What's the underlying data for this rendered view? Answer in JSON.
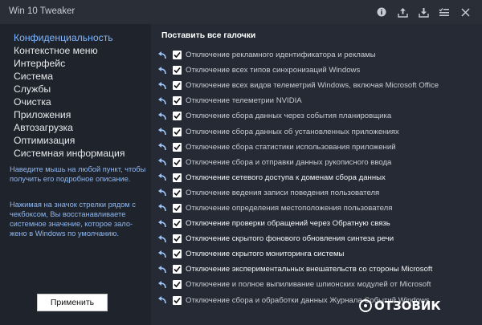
{
  "window": {
    "title": "Win 10 Tweaker"
  },
  "titlebar_icons": [
    "info-icon",
    "export-icon",
    "import-icon",
    "checklist-icon",
    "close-icon"
  ],
  "sidebar": {
    "items": [
      {
        "label": "Конфиденциальность",
        "active": true
      },
      {
        "label": "Контекстное меню",
        "active": false
      },
      {
        "label": "Интерфейс",
        "active": false
      },
      {
        "label": "Система",
        "active": false
      },
      {
        "label": "Службы",
        "active": false
      },
      {
        "label": "Очистка",
        "active": false
      },
      {
        "label": "Приложения",
        "active": false
      },
      {
        "label": "Автозагрузка",
        "active": false
      },
      {
        "label": "Оптимизация",
        "active": false
      },
      {
        "label": "Системная информация",
        "active": false
      }
    ],
    "hint1": "Наведите мышь на любой пункт, чтобы получить его подробное описание.",
    "hint2": "Нажимая на значок стрелки рядом с чекбоксом, Вы восстанавливаете системное значение, которое зало-\nжено в Windows по умолчанию.",
    "apply_label": "Применить"
  },
  "main": {
    "header": "Поставить все галочки",
    "options": [
      {
        "label": "Отключение рекламного идентификатора и рекламы",
        "checked": true,
        "bright": false
      },
      {
        "label": "Отключение всех типов синхронизаций Windows",
        "checked": true,
        "bright": false
      },
      {
        "label": "Отключение всех видов телеметрий Windows, включая Microsoft Office",
        "checked": true,
        "bright": false
      },
      {
        "label": "Отключение телеметрии NVIDIA",
        "checked": true,
        "bright": false
      },
      {
        "label": "Отключение сбора данных через события планировщика",
        "checked": true,
        "bright": false
      },
      {
        "label": "Отключение сбора данных об установленных приложениях",
        "checked": true,
        "bright": false
      },
      {
        "label": "Отключение сбора статистики использования приложений",
        "checked": true,
        "bright": false
      },
      {
        "label": "Отключение сбора и отправки данных рукописного ввода",
        "checked": true,
        "bright": false
      },
      {
        "label": "Отключение сетевого доступа к доменам сбора данных",
        "checked": true,
        "bright": true
      },
      {
        "label": "Отключение ведения записи поведения пользователя",
        "checked": true,
        "bright": false
      },
      {
        "label": "Отключение определения местоположения пользователя",
        "checked": true,
        "bright": false
      },
      {
        "label": "Отключение проверки обращений через Обратную связь",
        "checked": true,
        "bright": true
      },
      {
        "label": "Отключение скрытого фонового обновления синтеза речи",
        "checked": true,
        "bright": true
      },
      {
        "label": "Отключение скрытого мониторинга системы",
        "checked": true,
        "bright": true
      },
      {
        "label": "Отключение экспериментальных внешательств со стороны Microsoft",
        "checked": true,
        "bright": true
      },
      {
        "label": "Отключение и полное выпиливание шпионских модулей от Microsoft",
        "checked": true,
        "bright": false
      },
      {
        "label": "Отключение сбора и обработки данных Журнала Событий Windows",
        "checked": true,
        "bright": false
      }
    ]
  },
  "watermark": "ОТЗОВИК",
  "colors": {
    "accent": "#7fb6ff",
    "hint_text": "#8fb8f2",
    "undo_arrow": "#9fc4f5",
    "background": "#242831",
    "sidebar_bg": "#1f232c"
  }
}
